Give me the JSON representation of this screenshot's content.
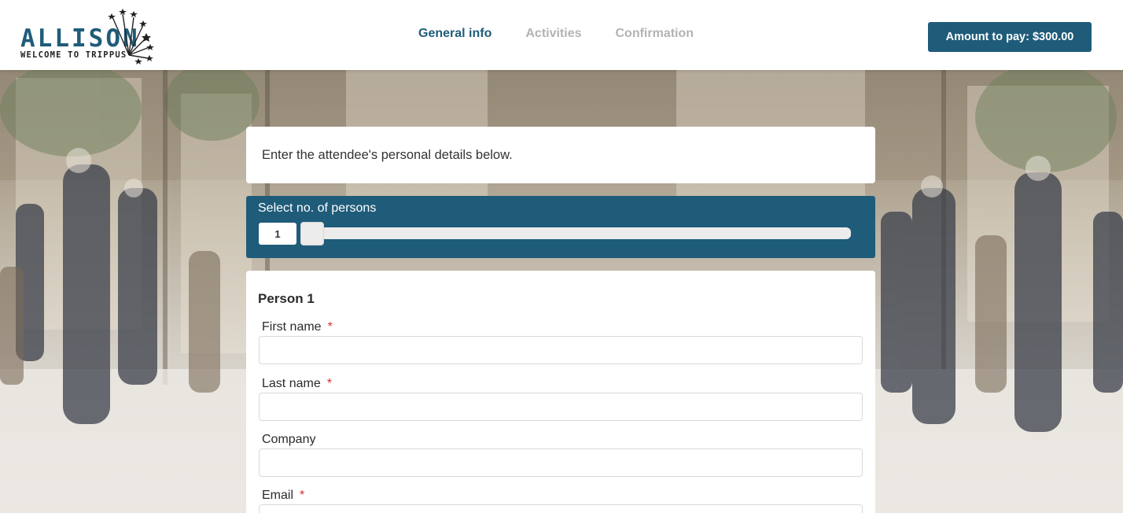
{
  "header": {
    "logo_word": "ALLISON",
    "logo_tagline": "WELCOME TO TRIPPUS",
    "nav": [
      {
        "label": "General info",
        "active": true
      },
      {
        "label": "Activities",
        "active": false
      },
      {
        "label": "Confirmation",
        "active": false
      }
    ],
    "pay_button": "Amount to pay: $300.00"
  },
  "intro": {
    "text": "Enter the attendee's personal details below."
  },
  "persons": {
    "label": "Select no. of persons",
    "count": "1",
    "slider_fraction": 0.0
  },
  "form": {
    "title": "Person 1",
    "fields": [
      {
        "label": "First name",
        "required": true,
        "value": ""
      },
      {
        "label": "Last name",
        "required": true,
        "value": ""
      },
      {
        "label": "Company",
        "required": false,
        "value": ""
      },
      {
        "label": "Email",
        "required": true,
        "value": ""
      }
    ],
    "required_marker": "*"
  },
  "colors": {
    "brand": "#1f5c7a",
    "inactive_nav": "#b3b3b3",
    "required": "#d0312d"
  }
}
